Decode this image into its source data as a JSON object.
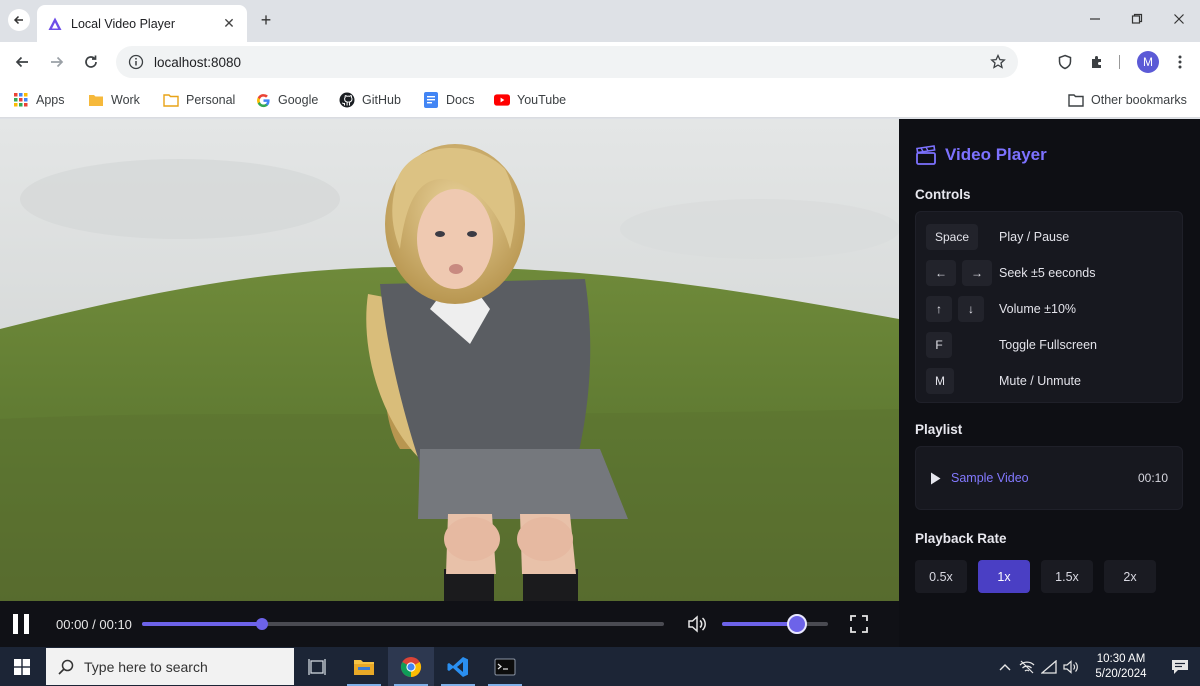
{
  "browser": {
    "tab_title": "Local Video Player",
    "tab_close": "✕",
    "new_tab": "+",
    "url": "localhost:8080",
    "avatar_initial": "M",
    "bookmarks": [
      {
        "label": "Apps",
        "icon": "apps-grid-icon"
      },
      {
        "label": "Work",
        "icon": "folder-icon"
      },
      {
        "label": "Personal",
        "icon": "folder-icon"
      },
      {
        "label": "Google",
        "icon": "google-icon"
      },
      {
        "label": "GitHub",
        "icon": "github-icon"
      },
      {
        "label": "Docs",
        "icon": "docs-icon"
      },
      {
        "label": "YouTube",
        "icon": "youtube-icon"
      }
    ],
    "other_bookmarks": "Other bookmarks"
  },
  "player": {
    "current_time": "00:00",
    "duration": "00:10",
    "time_display": "00:00 / 00:10",
    "seek_progress": 0.23,
    "volume": 0.71,
    "state": "playing"
  },
  "panel": {
    "title": "Video Player",
    "controls_heading": "Controls",
    "shortcuts": [
      {
        "keys": [
          "Space"
        ],
        "action": "Play / Pause"
      },
      {
        "keys": [
          "←",
          "→"
        ],
        "action": "Seek ±5 eeconds"
      },
      {
        "keys": [
          "↑",
          "↓"
        ],
        "action": "Volume ±10%"
      },
      {
        "keys": [
          "F"
        ],
        "action": "Toggle Fullscreen"
      },
      {
        "keys": [
          "M"
        ],
        "action": "Mute / Unmute"
      }
    ],
    "playlist_heading": "Playlist",
    "playlist": [
      {
        "name": "Sample Video",
        "duration": "00:10"
      }
    ],
    "playback_rate_heading": "Playback Rate",
    "rates": [
      "0.5x",
      "1x",
      "1.5x",
      "2x"
    ],
    "active_rate": "1x"
  },
  "taskbar": {
    "search_placeholder": "Type here to search",
    "time": "10:30 AM",
    "date": "5/20/2024"
  },
  "colors": {
    "accent": "#6d63e9",
    "panel_bg": "#0e0f14",
    "taskbar_bg": "#1c2536"
  }
}
